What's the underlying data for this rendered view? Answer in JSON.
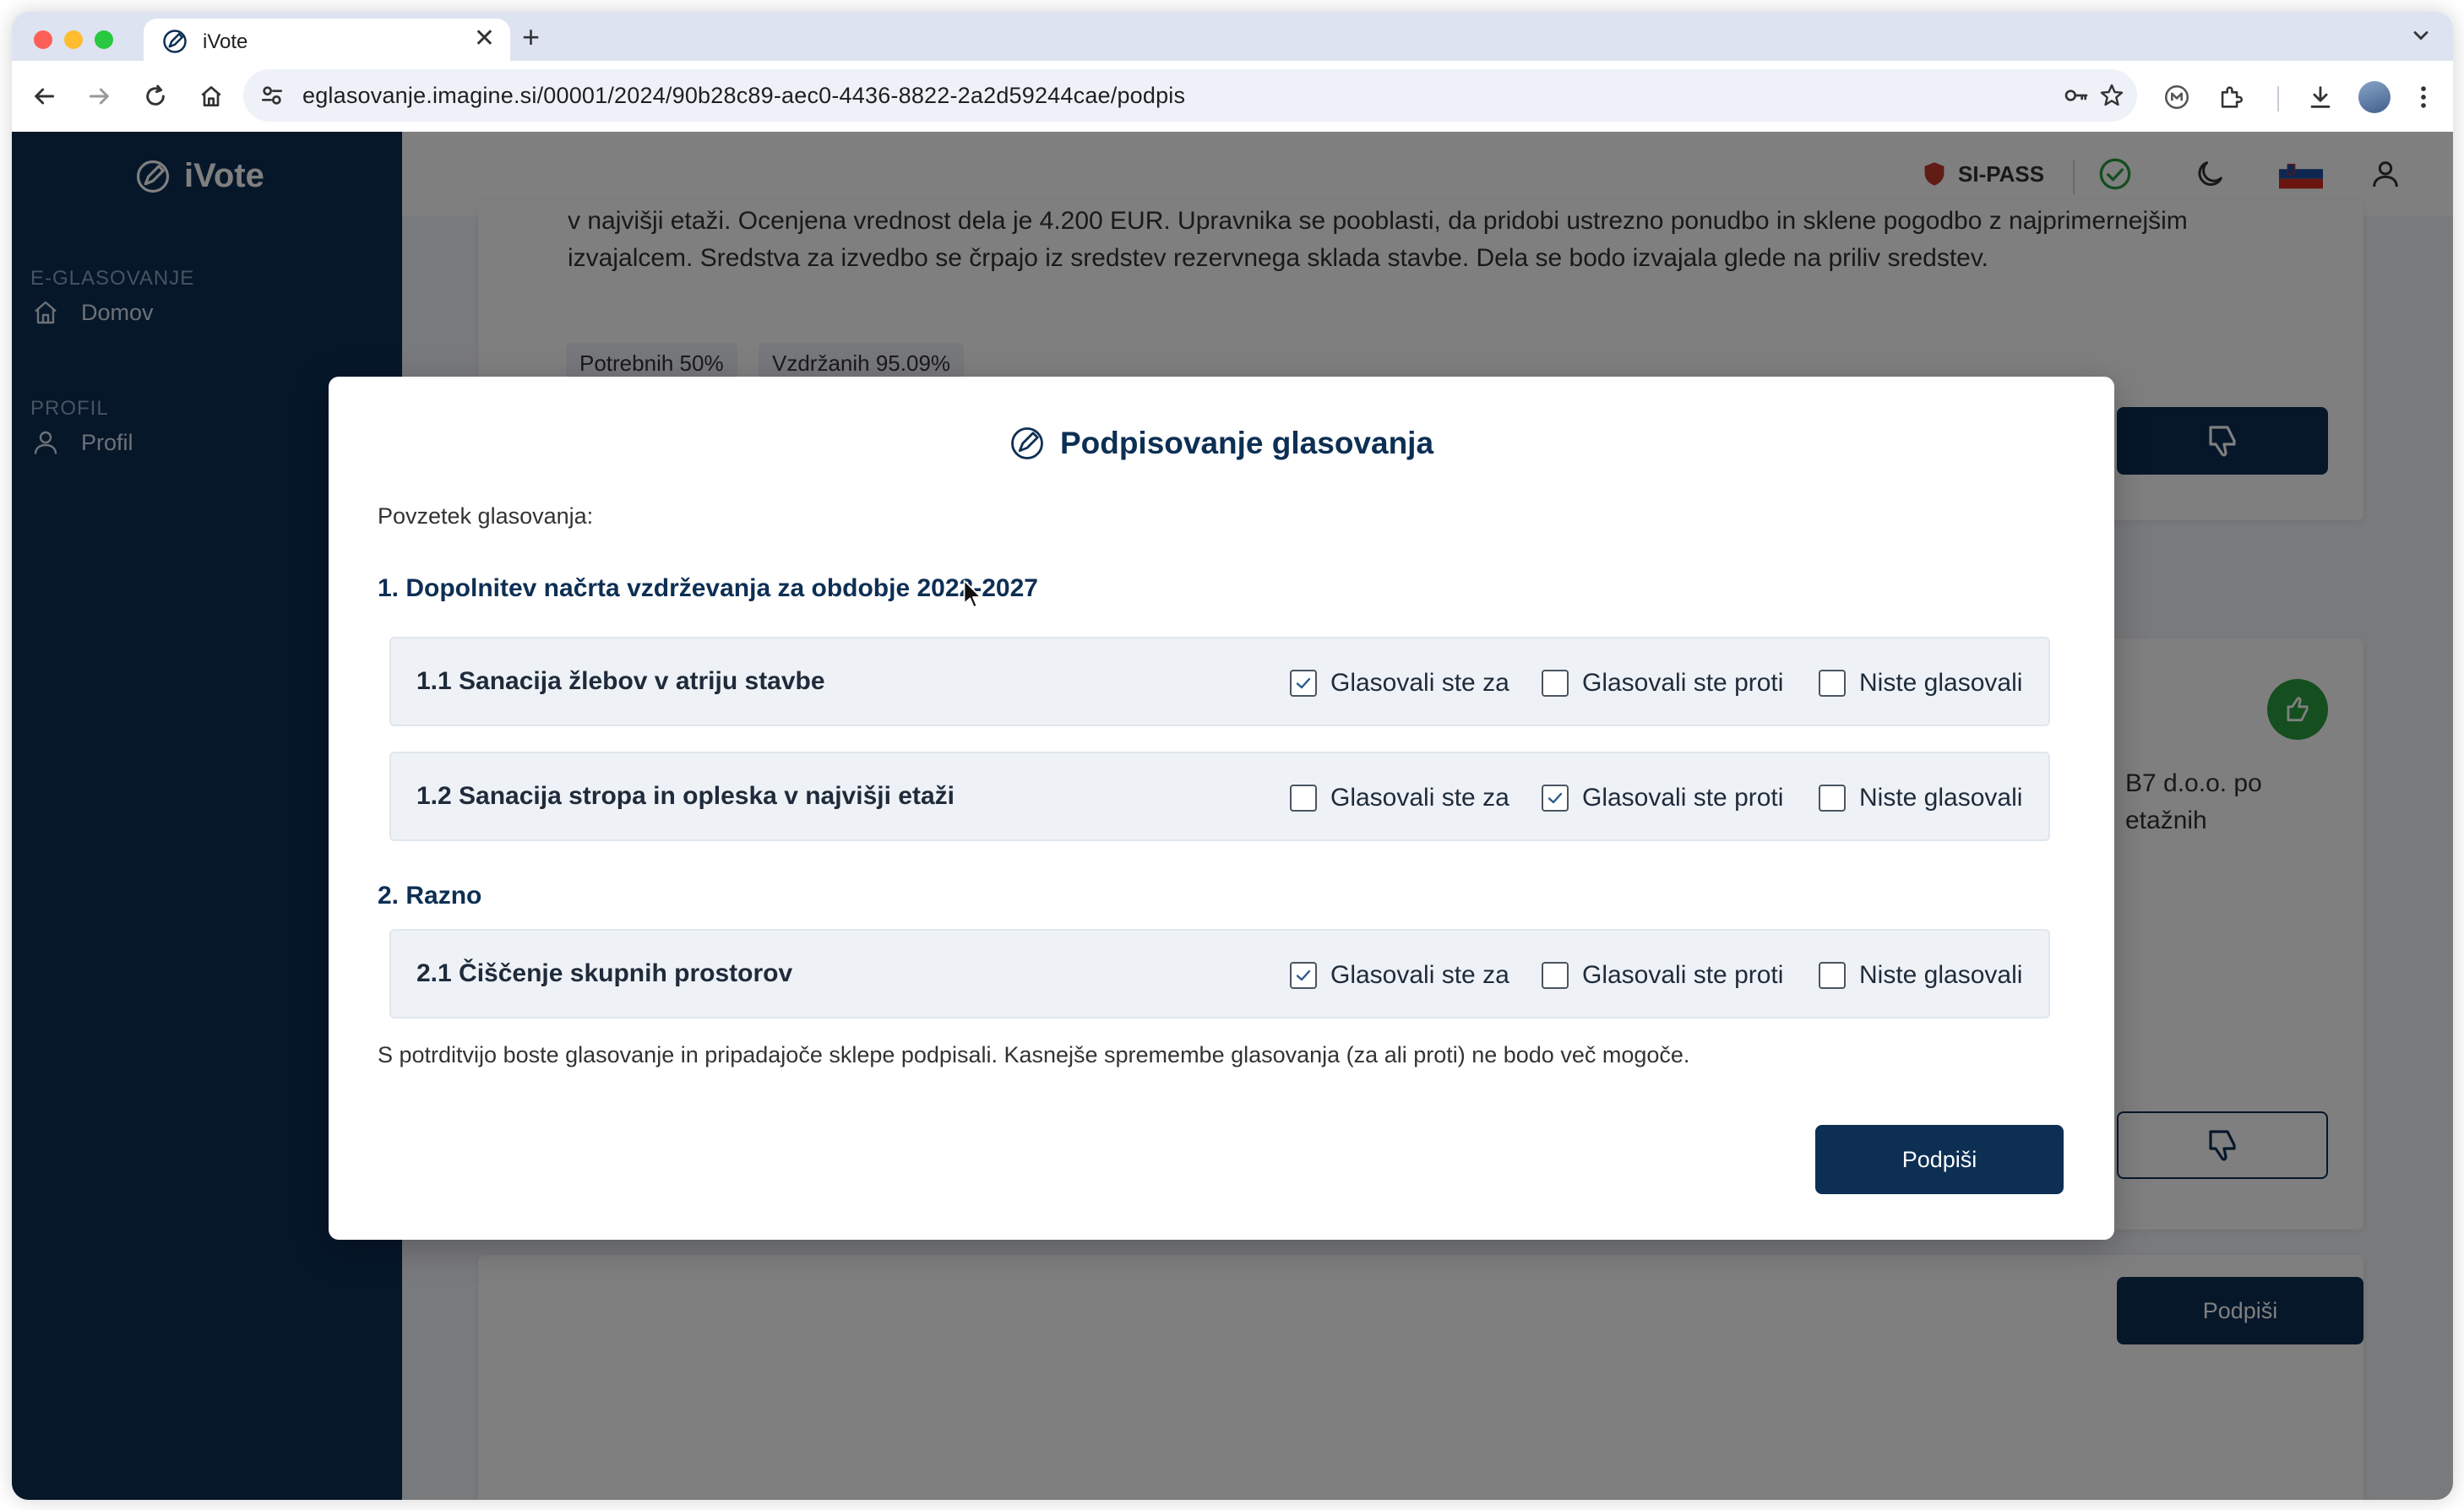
{
  "browser": {
    "tab_title": "iVote",
    "tab_close": "✕",
    "new_tab": "+",
    "url": "eglasovanje.imagine.si/00001/2024/90b28c89-aec0-4436-8822-2a2d59244cae/podpis"
  },
  "app": {
    "brand": "iVote",
    "sidebar": {
      "section_voting": "E-GLASOVANJE",
      "item_home": "Domov",
      "section_profile": "PROFIL",
      "item_profile": "Profil"
    },
    "topbar": {
      "sipass_label": "SI-PASS"
    }
  },
  "background": {
    "card1_text": "v najvišji etaži. Ocenjena vrednost dela je 4.200 EUR. Upravnika se pooblasti, da pridobi ustrezno ponudbo in sklene pogodbo z najprimernejšim izvajalcem. Sredstva za izvedbo se črpajo iz sredstev rezervnega sklada stavbe. Dela se bodo izvajala glede na priliv sredstev.",
    "badge_required": "Potrebnih 50%",
    "badge_abstained": "Vzdržanih 95.09%",
    "card2_text": "B7 d.o.o. po etažnih",
    "sign_button": "Podpiši"
  },
  "modal": {
    "title": "Podpisovanje glasovanja",
    "summary_label": "Povzetek glasovanja:",
    "sections": [
      {
        "title": "1. Dopolnitev načrta vzdrževanja za obdobje 2022-2027",
        "items": [
          {
            "label": "1.1 Sanacija žlebov v atriju stavbe",
            "opt_for": "Glasovali ste za",
            "opt_against": "Glasovali ste proti",
            "opt_none": "Niste glasovali",
            "selected": "for"
          },
          {
            "label": "1.2 Sanacija stropa in opleska v najvišji etaži",
            "opt_for": "Glasovali ste za",
            "opt_against": "Glasovali ste proti",
            "opt_none": "Niste glasovali",
            "selected": "against"
          }
        ]
      },
      {
        "title": "2. Razno",
        "items": [
          {
            "label": "2.1 Čiščenje skupnih prostorov",
            "opt_for": "Glasovali ste za",
            "opt_against": "Glasovali ste proti",
            "opt_none": "Niste glasovali",
            "selected": "for"
          }
        ]
      }
    ],
    "note": "S potrditvijo boste glasovanje in pripadajoče sklepe podpisali. Kasnejše spremembe glasovanja (za ali proti) ne bodo več mogoče.",
    "sign_button": "Podpiši"
  },
  "colors": {
    "primary": "#0d2f54",
    "overlay": "rgba(0,0,0,0.5)",
    "success": "#2a9d3e"
  }
}
